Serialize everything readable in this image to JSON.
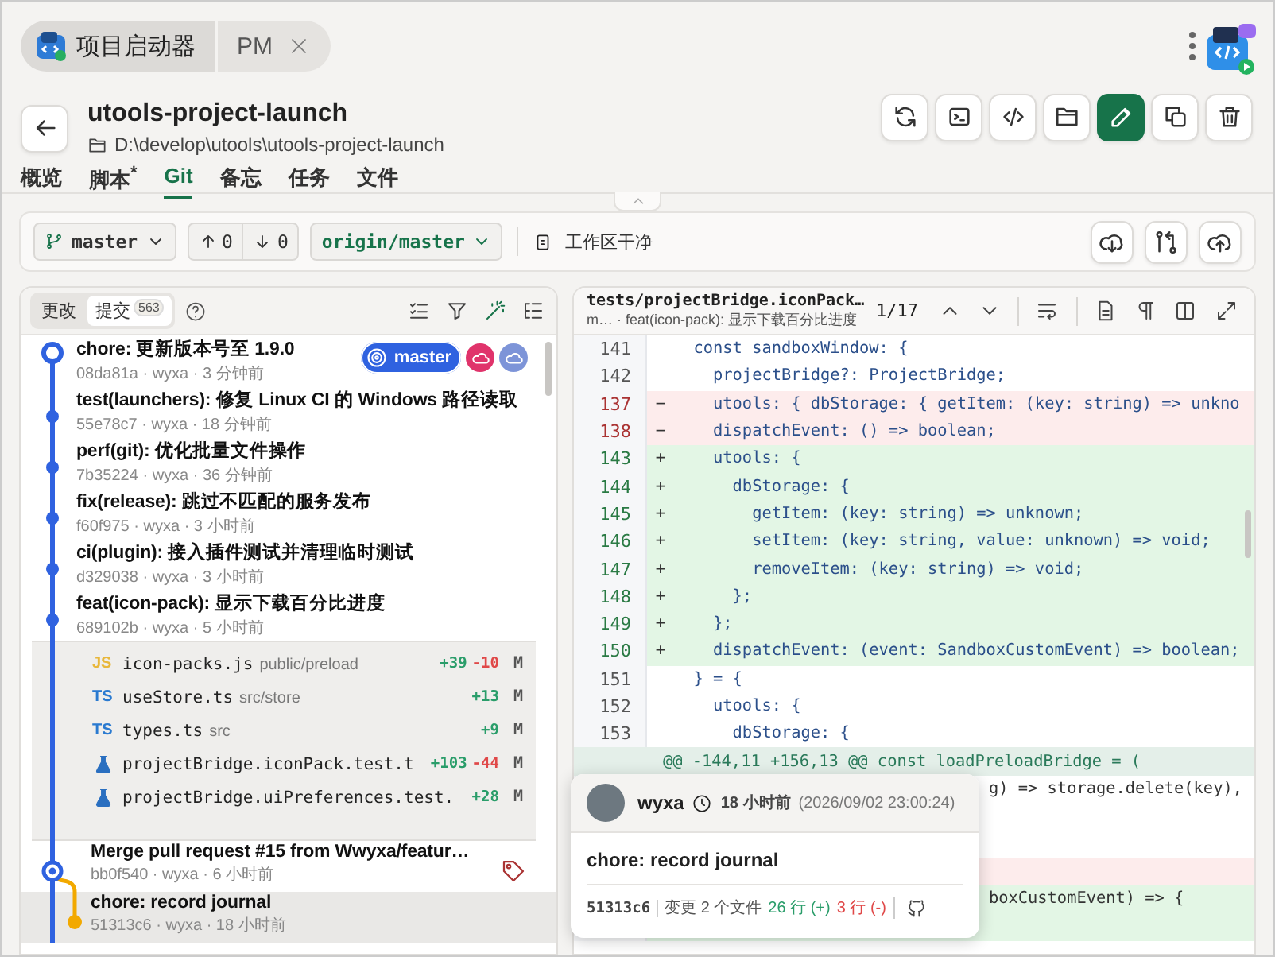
{
  "app_tab": {
    "title": "项目启动器",
    "subtitle": "PM"
  },
  "project": {
    "name": "utools-project-launch",
    "path": "D:\\develop\\utools\\utools-project-launch"
  },
  "actions": [
    {
      "kind": "refresh",
      "primary": false
    },
    {
      "kind": "terminal",
      "primary": false
    },
    {
      "kind": "code",
      "primary": false
    },
    {
      "kind": "folder",
      "primary": false
    },
    {
      "kind": "edit",
      "primary": true
    },
    {
      "kind": "copy",
      "primary": false
    },
    {
      "kind": "trash",
      "primary": false
    }
  ],
  "tabs": [
    {
      "label": "概览",
      "selected": false
    },
    {
      "label": "脚本",
      "marker": "*",
      "selected": false
    },
    {
      "label": "Git",
      "selected": true
    },
    {
      "label": "备忘",
      "selected": false
    },
    {
      "label": "任务",
      "selected": false
    },
    {
      "label": "文件",
      "selected": false
    }
  ],
  "git_bar": {
    "branch": "master",
    "ahead": "0",
    "behind": "0",
    "remote": "origin/master",
    "status": "工作区干净",
    "actions": [
      {
        "kind": "cloud-down"
      },
      {
        "kind": "compare"
      },
      {
        "kind": "cloud-up"
      }
    ]
  },
  "history": {
    "segments": [
      {
        "label": "更改",
        "selected": false
      },
      {
        "label": "提交",
        "count": "563",
        "selected": true
      }
    ],
    "tools": [
      {
        "kind": "list-check",
        "active": false
      },
      {
        "kind": "filter",
        "active": false
      },
      {
        "kind": "wand",
        "active": true
      },
      {
        "kind": "list-tree",
        "active": false
      }
    ],
    "commits": [
      {
        "kind": "head",
        "title": "chore: 更新版本号至 1.9.0",
        "meta": "08da81a · wyxa · 3 分钟前",
        "selected": false,
        "refs": [
          {
            "kind": "branch",
            "label": "master",
            "color": "#2f62e0"
          },
          {
            "kind": "remote",
            "color": "#e0336b"
          },
          {
            "kind": "remote",
            "color": "#7d94d8"
          }
        ]
      },
      {
        "kind": "dot",
        "title": "test(launchers): 修复 Linux CI 的 Windows 路径读取",
        "meta": "55e78c7 · wyxa · 18 分钟前",
        "selected": false
      },
      {
        "kind": "dot",
        "title": "perf(git): 优化批量文件操作",
        "meta": "7b35224 · wyxa · 36 分钟前",
        "selected": false
      },
      {
        "kind": "dot",
        "title": "fix(release): 跳过不匹配的服务发布",
        "meta": "f60f975 · wyxa · 3 小时前",
        "selected": false
      },
      {
        "kind": "dot",
        "title": "ci(plugin): 接入插件测试并清理临时测试",
        "meta": "d329038 · wyxa · 3 小时前",
        "selected": false
      },
      {
        "kind": "dot",
        "title": "feat(icon-pack): 显示下载百分比进度",
        "meta": "689102b · wyxa · 5 小时前",
        "selected": false,
        "expanded": true,
        "files": [
          {
            "kind": "js",
            "badge": "JS",
            "name": "icon-packs.js",
            "path": "public/preload",
            "added": "+39",
            "removed": "-10",
            "status": "M"
          },
          {
            "kind": "ts",
            "badge": "TS",
            "name": "useStore.ts",
            "path": "src/store",
            "added": "+13",
            "status": "M"
          },
          {
            "kind": "ts",
            "badge": "TS",
            "name": "types.ts",
            "path": "src",
            "added": "+9",
            "status": "M"
          },
          {
            "kind": "test",
            "name": "projectBridge.iconPack.test.t",
            "added": "+103",
            "removed": "-44",
            "status": "M"
          },
          {
            "kind": "test",
            "name": "projectBridge.uiPreferences.test.",
            "added": "+28",
            "status": "M"
          }
        ]
      },
      {
        "kind": "merge",
        "title": "Merge pull request #15 from Wwyxa/featur…",
        "meta": "bb0f540 · wyxa · 6 小时前",
        "selected": false,
        "tag": true
      },
      {
        "kind": "side",
        "title": "chore: record journal",
        "meta": "51313c6 · wyxa · 18 小时前",
        "selected": true
      }
    ]
  },
  "diff": {
    "file": "tests/projectBridge.iconPack…",
    "context": "m… · feat(icon-pack): 显示下载百分比进度",
    "position": "1/17",
    "lines": [
      {
        "kind": "ctx",
        "num": "141",
        "text": "  const sandboxWindow: {"
      },
      {
        "kind": "ctx",
        "num": "142",
        "text": "    projectBridge?: ProjectBridge;"
      },
      {
        "kind": "del",
        "num": "137",
        "sign": "−",
        "text": "    utools: { dbStorage: { getItem: (key: string) => unkno"
      },
      {
        "kind": "del",
        "num": "138",
        "sign": "−",
        "text": "    dispatchEvent: () => boolean;"
      },
      {
        "kind": "add",
        "num": "143",
        "sign": "+",
        "text": "    utools: {"
      },
      {
        "kind": "add",
        "num": "144",
        "sign": "+",
        "text": "      dbStorage: {"
      },
      {
        "kind": "add",
        "num": "145",
        "sign": "+",
        "text": "        getItem: (key: string) => unknown;"
      },
      {
        "kind": "add",
        "num": "146",
        "sign": "+",
        "text": "        setItem: (key: string, value: unknown) => void;"
      },
      {
        "kind": "add",
        "num": "147",
        "sign": "+",
        "text": "        removeItem: (key: string) => void;"
      },
      {
        "kind": "add",
        "num": "148",
        "sign": "+",
        "text": "      };"
      },
      {
        "kind": "add",
        "num": "149",
        "sign": "+",
        "text": "    };"
      },
      {
        "kind": "add",
        "num": "150",
        "sign": "+",
        "text": "    dispatchEvent: (event: SandboxCustomEvent) => boolean;"
      },
      {
        "kind": "ctx",
        "num": "151",
        "text": "  } = {"
      },
      {
        "kind": "ctx",
        "num": "152",
        "text": "    utools: {"
      },
      {
        "kind": "ctx",
        "num": "153",
        "text": "      dbStorage: {"
      },
      {
        "kind": "hunk",
        "text": "@@ -144,11 +156,13 @@ const loadPreloadBridge = ("
      },
      {
        "kind": "ctx",
        "covered": true,
        "text": "g) => storage.delete(key),"
      },
      {
        "kind": "ctx"
      },
      {
        "kind": "ctx"
      },
      {
        "kind": "del"
      },
      {
        "kind": "add",
        "covered": true,
        "text": "boxCustomEvent) => {"
      },
      {
        "kind": "add"
      }
    ]
  },
  "popup": {
    "author": "wyxa",
    "time": "18 小时前",
    "date": "(2026/09/02 23:00:24)",
    "title": "chore: record journal",
    "hash": "51313c6",
    "files": "变更 2 个文件",
    "added": "26 行 (+)",
    "removed": "3 行 (-)"
  }
}
